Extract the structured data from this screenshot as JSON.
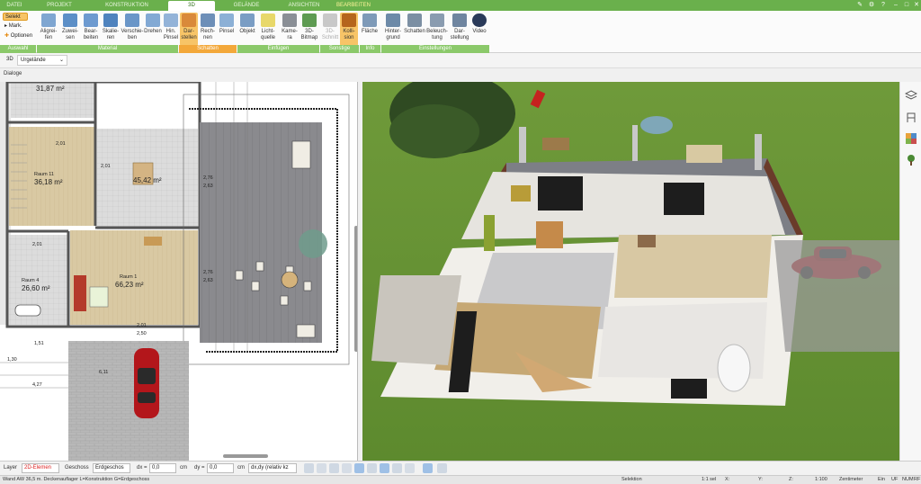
{
  "tabs": [
    {
      "label": "DATEI",
      "active": false
    },
    {
      "label": "PROJEKT",
      "active": false
    },
    {
      "label": "KONSTRUKTION",
      "active": false
    },
    {
      "label": "3D",
      "active": true
    },
    {
      "label": "GELÄNDE",
      "active": false
    },
    {
      "label": "ANSICHTEN",
      "active": false
    },
    {
      "label": "BEARBEITEN",
      "active": false
    }
  ],
  "auswahl": {
    "selekt": "Selekt",
    "mark": "Mark.",
    "optionen": "Optionen",
    "group": "Auswahl"
  },
  "material": {
    "group": "Material",
    "buttons": [
      "Aligrei-fen",
      "Zuwei-sen",
      "Bear-beiten",
      "Skalie-ren",
      "Verschie-ben",
      "Drehen",
      "Hin. Pinsel"
    ]
  },
  "schatten": {
    "group": "Schatten",
    "buttons": [
      "Dar-stellen",
      "Rech-nen",
      "Pinsel"
    ]
  },
  "einfuegen": {
    "group": "Einfügen",
    "buttons": [
      "Objekt",
      "Licht-quelle",
      "Kame-ra",
      "3D-Bitmap"
    ]
  },
  "sonstige": {
    "group": "Sonstige",
    "buttons": [
      "3D-Schnitt",
      "Kolli-sion"
    ]
  },
  "info": {
    "group": "Info",
    "buttons": [
      "Fläche"
    ]
  },
  "einstellungen": {
    "group": "Einstellungen",
    "buttons": [
      "Hinter-grund",
      "Schatten",
      "Beleuch-tung",
      "Dar-stellung",
      "Video"
    ]
  },
  "viewbar": {
    "mode": "3D",
    "selection": "Urgelände"
  },
  "dialog_label": "Dialoge",
  "plan": {
    "rooms": [
      {
        "name": "",
        "area": "31,87 m²"
      },
      {
        "name": "Raum 11",
        "area": "36,18 m²"
      },
      {
        "name": "",
        "area": "45,42 m²"
      },
      {
        "name": "Raum 4",
        "area": "26,60 m²"
      },
      {
        "name": "Raum 1",
        "area": "66,23 m²"
      }
    ],
    "dims": [
      "2,01",
      "2,01",
      "2,01",
      "2,76",
      "2,63",
      "2,76",
      "2,63",
      "2,01",
      "2,50",
      "1,51",
      "1,30",
      "4,27",
      "6,11"
    ]
  },
  "bottombar": {
    "layer_label": "Layer",
    "layer_value": "2D-Elemen",
    "geschoss_label": "Geschoss",
    "geschoss_value": "Erdgeschos",
    "dx_label": "dx =",
    "dx_value": "0,0",
    "dx_unit": "cm",
    "dy_label": "dy =",
    "dy_value": "0,0",
    "dy_unit": "cm",
    "mode_value": "dx,dy (relativ kz"
  },
  "statusbar": {
    "left": "Wand AW 36,5 m. Deckenauflager L=Konstruktion G=Erdgeschoss",
    "selektion": "Selektion",
    "scale1": "1:1 sel",
    "x": "X:",
    "y": "Y:",
    "z": "Z:",
    "scale2": "1:100",
    "unit": "Zentimeter",
    "ein": "Ein",
    "uf": "UF",
    "num": "NUM",
    "rf": "RF"
  }
}
